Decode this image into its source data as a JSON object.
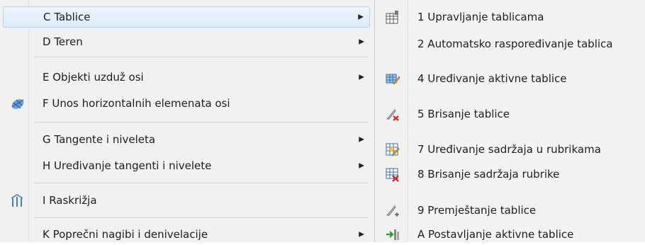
{
  "left_menu": {
    "items": [
      {
        "label": "C Tablice",
        "has_submenu": true,
        "highlighted": true
      },
      {
        "label": "D Teren",
        "has_submenu": true
      },
      {
        "label": "E Objekti uzduž osi",
        "has_submenu": true
      },
      {
        "label": "F Unos horizontalnih elemenata osi",
        "has_submenu": false,
        "icon": "horizontal-elements-icon"
      },
      {
        "label": "G Tangente i niveleta",
        "has_submenu": true
      },
      {
        "label": "H Uređivanje tangenti i nivelete",
        "has_submenu": true
      },
      {
        "label": "I Raskrižja",
        "has_submenu": false,
        "icon": "intersection-icon"
      },
      {
        "label": "K Poprečni nagibi i denivelacije",
        "has_submenu": true
      }
    ],
    "arrow_glyph": "▶"
  },
  "right_menu": {
    "items": [
      {
        "label": "1 Upravljanje tablicama",
        "icon": "table-manage-icon"
      },
      {
        "label": "2 Automatsko raspoređivanje tablica",
        "icon": ""
      },
      {
        "label": "4 Uređivanje aktivne tablice",
        "icon": "edit-table-icon"
      },
      {
        "label": "5 Brisanje tablice",
        "icon": "delete-table-icon"
      },
      {
        "label": "7 Uređivanje sadržaja u rubrikama",
        "icon": "edit-cells-icon"
      },
      {
        "label": "8 Brisanje sadržaja rubrike",
        "icon": "delete-cells-icon"
      },
      {
        "label": "9 Premještanje tablice",
        "icon": "move-table-icon"
      },
      {
        "label": "A Postavljanje aktivne tablice",
        "icon": "set-active-table-icon"
      }
    ]
  }
}
